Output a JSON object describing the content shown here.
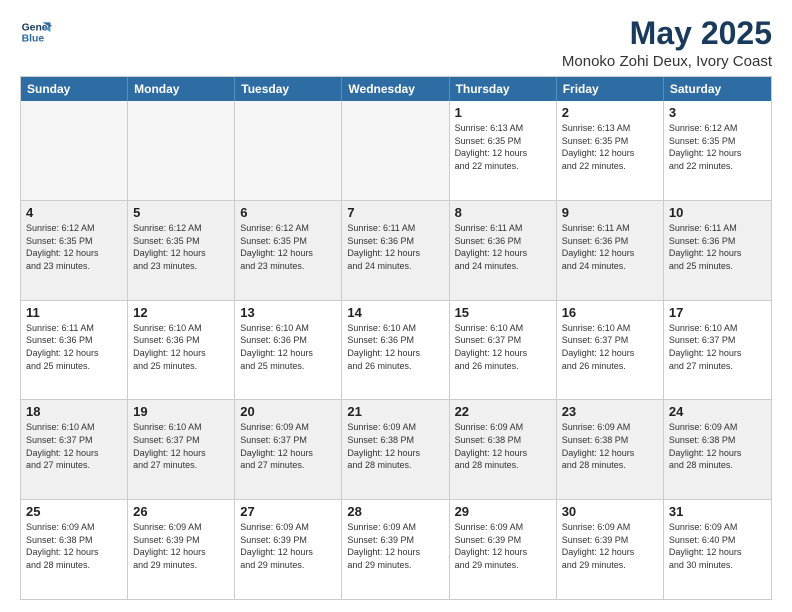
{
  "logo": {
    "line1": "General",
    "line2": "Blue"
  },
  "title": "May 2025",
  "subtitle": "Monoko Zohi Deux, Ivory Coast",
  "header_days": [
    "Sunday",
    "Monday",
    "Tuesday",
    "Wednesday",
    "Thursday",
    "Friday",
    "Saturday"
  ],
  "weeks": [
    [
      {
        "day": "",
        "detail": ""
      },
      {
        "day": "",
        "detail": ""
      },
      {
        "day": "",
        "detail": ""
      },
      {
        "day": "",
        "detail": ""
      },
      {
        "day": "1",
        "detail": "Sunrise: 6:13 AM\nSunset: 6:35 PM\nDaylight: 12 hours\nand 22 minutes."
      },
      {
        "day": "2",
        "detail": "Sunrise: 6:13 AM\nSunset: 6:35 PM\nDaylight: 12 hours\nand 22 minutes."
      },
      {
        "day": "3",
        "detail": "Sunrise: 6:12 AM\nSunset: 6:35 PM\nDaylight: 12 hours\nand 22 minutes."
      }
    ],
    [
      {
        "day": "4",
        "detail": "Sunrise: 6:12 AM\nSunset: 6:35 PM\nDaylight: 12 hours\nand 23 minutes."
      },
      {
        "day": "5",
        "detail": "Sunrise: 6:12 AM\nSunset: 6:35 PM\nDaylight: 12 hours\nand 23 minutes."
      },
      {
        "day": "6",
        "detail": "Sunrise: 6:12 AM\nSunset: 6:35 PM\nDaylight: 12 hours\nand 23 minutes."
      },
      {
        "day": "7",
        "detail": "Sunrise: 6:11 AM\nSunset: 6:36 PM\nDaylight: 12 hours\nand 24 minutes."
      },
      {
        "day": "8",
        "detail": "Sunrise: 6:11 AM\nSunset: 6:36 PM\nDaylight: 12 hours\nand 24 minutes."
      },
      {
        "day": "9",
        "detail": "Sunrise: 6:11 AM\nSunset: 6:36 PM\nDaylight: 12 hours\nand 24 minutes."
      },
      {
        "day": "10",
        "detail": "Sunrise: 6:11 AM\nSunset: 6:36 PM\nDaylight: 12 hours\nand 25 minutes."
      }
    ],
    [
      {
        "day": "11",
        "detail": "Sunrise: 6:11 AM\nSunset: 6:36 PM\nDaylight: 12 hours\nand 25 minutes."
      },
      {
        "day": "12",
        "detail": "Sunrise: 6:10 AM\nSunset: 6:36 PM\nDaylight: 12 hours\nand 25 minutes."
      },
      {
        "day": "13",
        "detail": "Sunrise: 6:10 AM\nSunset: 6:36 PM\nDaylight: 12 hours\nand 25 minutes."
      },
      {
        "day": "14",
        "detail": "Sunrise: 6:10 AM\nSunset: 6:36 PM\nDaylight: 12 hours\nand 26 minutes."
      },
      {
        "day": "15",
        "detail": "Sunrise: 6:10 AM\nSunset: 6:37 PM\nDaylight: 12 hours\nand 26 minutes."
      },
      {
        "day": "16",
        "detail": "Sunrise: 6:10 AM\nSunset: 6:37 PM\nDaylight: 12 hours\nand 26 minutes."
      },
      {
        "day": "17",
        "detail": "Sunrise: 6:10 AM\nSunset: 6:37 PM\nDaylight: 12 hours\nand 27 minutes."
      }
    ],
    [
      {
        "day": "18",
        "detail": "Sunrise: 6:10 AM\nSunset: 6:37 PM\nDaylight: 12 hours\nand 27 minutes."
      },
      {
        "day": "19",
        "detail": "Sunrise: 6:10 AM\nSunset: 6:37 PM\nDaylight: 12 hours\nand 27 minutes."
      },
      {
        "day": "20",
        "detail": "Sunrise: 6:09 AM\nSunset: 6:37 PM\nDaylight: 12 hours\nand 27 minutes."
      },
      {
        "day": "21",
        "detail": "Sunrise: 6:09 AM\nSunset: 6:38 PM\nDaylight: 12 hours\nand 28 minutes."
      },
      {
        "day": "22",
        "detail": "Sunrise: 6:09 AM\nSunset: 6:38 PM\nDaylight: 12 hours\nand 28 minutes."
      },
      {
        "day": "23",
        "detail": "Sunrise: 6:09 AM\nSunset: 6:38 PM\nDaylight: 12 hours\nand 28 minutes."
      },
      {
        "day": "24",
        "detail": "Sunrise: 6:09 AM\nSunset: 6:38 PM\nDaylight: 12 hours\nand 28 minutes."
      }
    ],
    [
      {
        "day": "25",
        "detail": "Sunrise: 6:09 AM\nSunset: 6:38 PM\nDaylight: 12 hours\nand 28 minutes."
      },
      {
        "day": "26",
        "detail": "Sunrise: 6:09 AM\nSunset: 6:39 PM\nDaylight: 12 hours\nand 29 minutes."
      },
      {
        "day": "27",
        "detail": "Sunrise: 6:09 AM\nSunset: 6:39 PM\nDaylight: 12 hours\nand 29 minutes."
      },
      {
        "day": "28",
        "detail": "Sunrise: 6:09 AM\nSunset: 6:39 PM\nDaylight: 12 hours\nand 29 minutes."
      },
      {
        "day": "29",
        "detail": "Sunrise: 6:09 AM\nSunset: 6:39 PM\nDaylight: 12 hours\nand 29 minutes."
      },
      {
        "day": "30",
        "detail": "Sunrise: 6:09 AM\nSunset: 6:39 PM\nDaylight: 12 hours\nand 29 minutes."
      },
      {
        "day": "31",
        "detail": "Sunrise: 6:09 AM\nSunset: 6:40 PM\nDaylight: 12 hours\nand 30 minutes."
      }
    ]
  ]
}
